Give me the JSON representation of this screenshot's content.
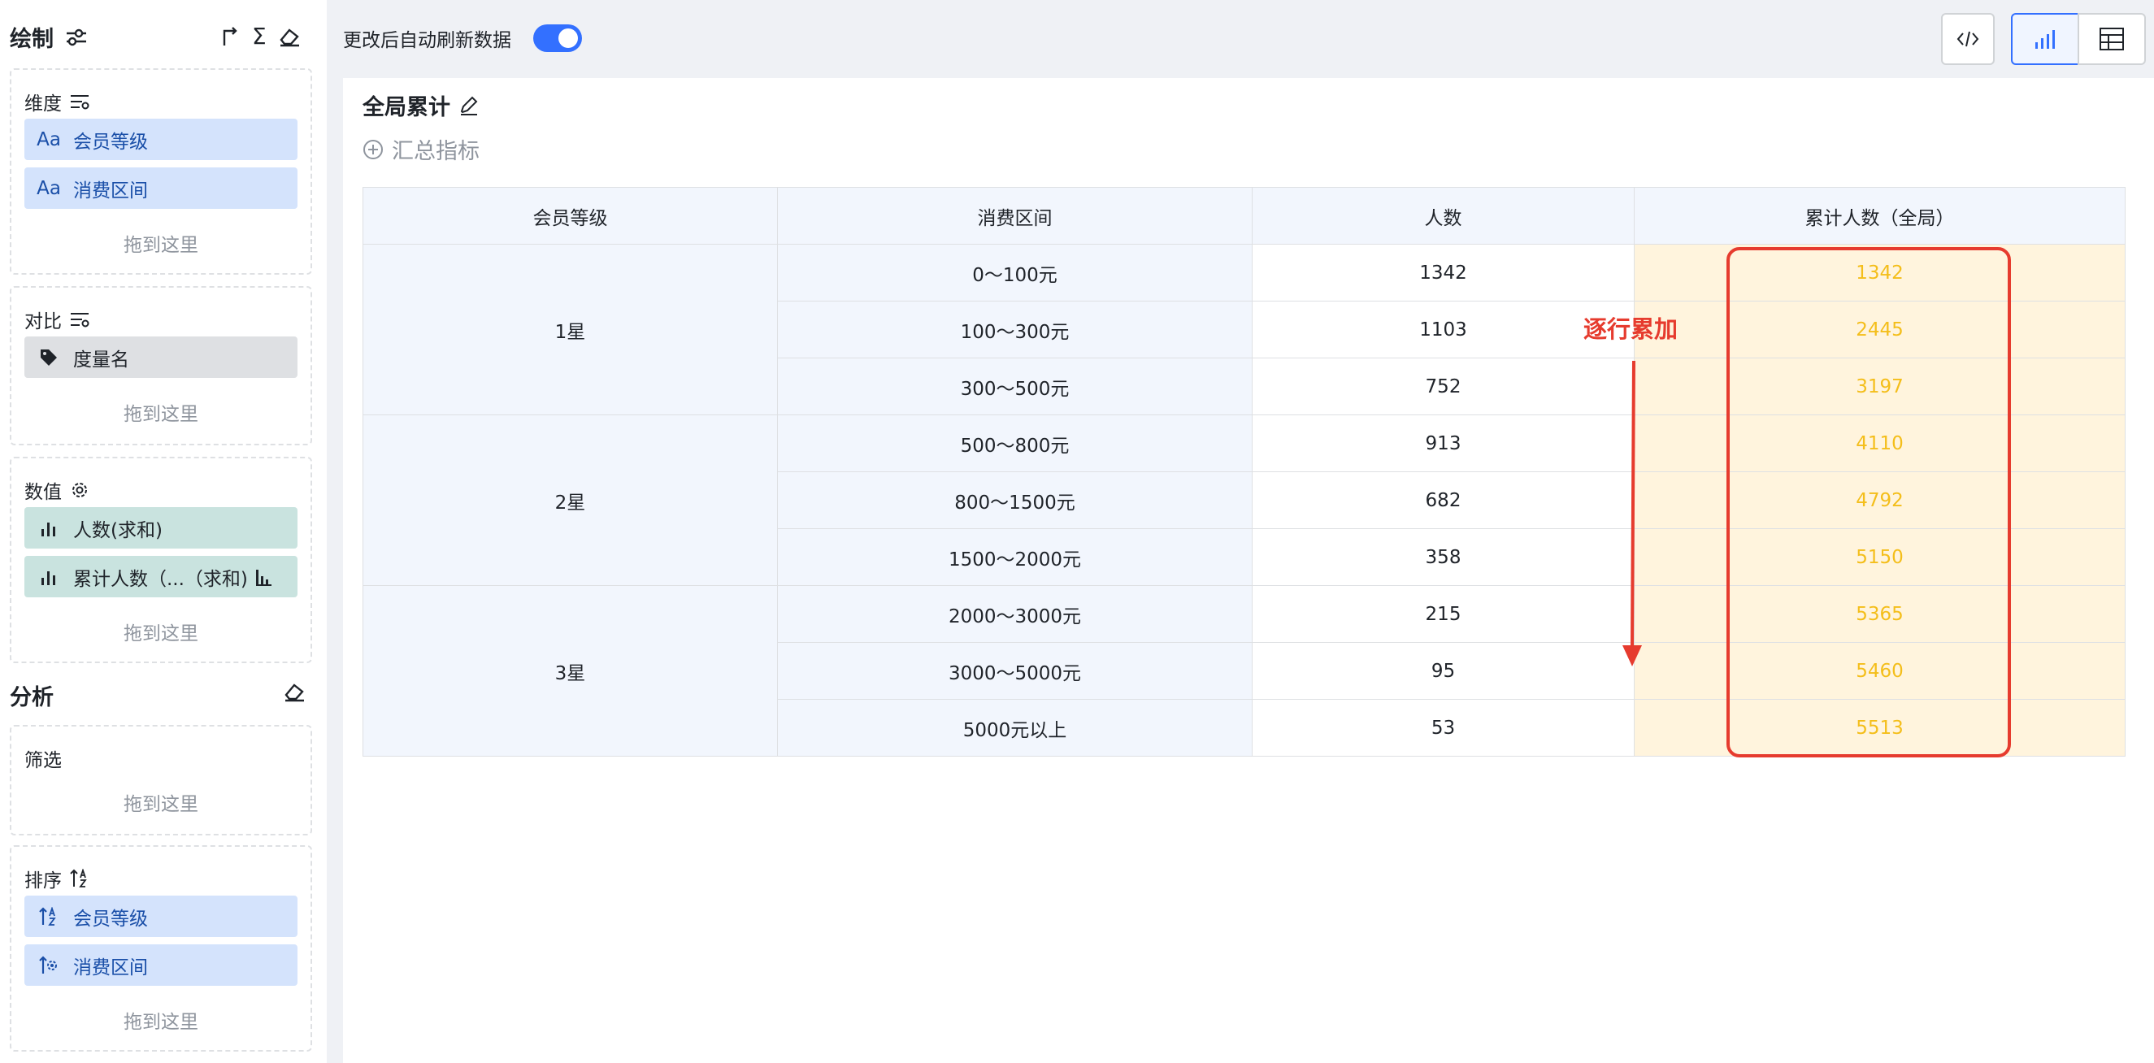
{
  "sidebar": {
    "draw_title": "绘制",
    "dimension": {
      "label": "维度",
      "items": [
        {
          "icon": "text-type-icon",
          "glyph": "Aa",
          "label": "会员等级"
        },
        {
          "icon": "text-type-icon",
          "glyph": "Aa",
          "label": "消费区间"
        }
      ],
      "drop_hint": "拖到这里"
    },
    "compare": {
      "label": "对比",
      "items": [
        {
          "icon": "tag-icon",
          "label": "度量名"
        }
      ],
      "drop_hint": "拖到这里"
    },
    "values": {
      "label": "数值",
      "items": [
        {
          "icon": "bar-chart-icon",
          "label": "人数(求和)"
        },
        {
          "icon": "bar-chart-icon",
          "label": "累计人数（...（求和)"
        }
      ],
      "drop_hint": "拖到这里"
    },
    "analysis_title": "分析",
    "filter": {
      "label": "筛选",
      "drop_hint": "拖到这里"
    },
    "sort": {
      "label": "排序",
      "items": [
        {
          "icon": "sort-asc-icon",
          "label": "会员等级"
        },
        {
          "icon": "sort-custom-icon",
          "label": "消费区间"
        }
      ],
      "drop_hint": "拖到这里"
    }
  },
  "topbar": {
    "auto_refresh_label": "更改后自动刷新数据",
    "auto_refresh_on": true
  },
  "card": {
    "title": "全局累计",
    "add_metric_label": "汇总指标"
  },
  "table": {
    "headers": [
      "会员等级",
      "消费区间",
      "人数",
      "累计人数（全局）"
    ],
    "groups": [
      {
        "level": "1星",
        "rows": [
          {
            "range": "0～100元",
            "count": "1342",
            "cumulative": "1342"
          },
          {
            "range": "100～300元",
            "count": "1103",
            "cumulative": "2445"
          },
          {
            "range": "300～500元",
            "count": "752",
            "cumulative": "3197"
          }
        ]
      },
      {
        "level": "2星",
        "rows": [
          {
            "range": "500～800元",
            "count": "913",
            "cumulative": "4110"
          },
          {
            "range": "800～1500元",
            "count": "682",
            "cumulative": "4792"
          },
          {
            "range": "1500～2000元",
            "count": "358",
            "cumulative": "5150"
          }
        ]
      },
      {
        "level": "3星",
        "rows": [
          {
            "range": "2000～3000元",
            "count": "215",
            "cumulative": "5365"
          },
          {
            "range": "3000～5000元",
            "count": "95",
            "cumulative": "5460"
          },
          {
            "range": "5000元以上",
            "count": "53",
            "cumulative": "5513"
          }
        ]
      }
    ]
  },
  "annotation": {
    "text": "逐行累加"
  },
  "colors": {
    "accent": "#3370ff",
    "highlight": "#e63b2e",
    "cumulative_text": "#f4be1a",
    "cumulative_bg": "#fff4dd"
  }
}
